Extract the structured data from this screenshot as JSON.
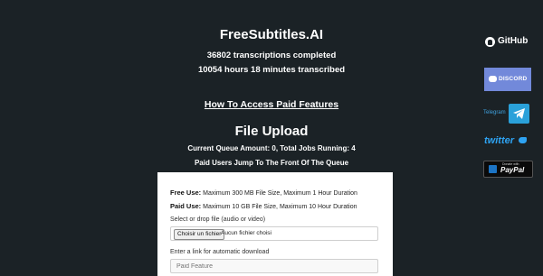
{
  "header": {
    "title": "FreeSubtitles.AI",
    "stats_transcriptions": "36802 transcriptions completed",
    "stats_hours": "10054 hours 18 minutes transcribed"
  },
  "links": {
    "paid_features": "How To Access Paid Features"
  },
  "upload": {
    "heading": "File Upload",
    "queue_status": "Current Queue Amount: 0, Total Jobs Running: 4",
    "priority_note": "Paid Users Jump To The Front Of The Queue"
  },
  "card": {
    "free_label": "Free Use:",
    "free_text": "Maximum 300 MB File Size, Maximum 1 Hour Duration",
    "paid_label": "Paid Use:",
    "paid_text": "Maximum 10 GB File Size, Maximum 10 Hour Duration",
    "select_label": "Select or drop file (audio or video)",
    "file_button": "Choisir un fichier",
    "file_status": "Aucun fichier choisi",
    "link_label": "Enter a link for automatic download",
    "link_placeholder": "Paid Feature"
  },
  "sidebar": {
    "github": "GitHub",
    "discord": "DISCORD",
    "telegram": "Telegram",
    "twitter": "twitter",
    "paypal_small": "Donate with",
    "paypal": "PayPal"
  },
  "icons": [
    "github-icon",
    "discord-icon",
    "telegram-icon",
    "twitter-icon",
    "paypal-icon"
  ],
  "colors": {
    "background": "#1b2226",
    "discord": "#7289da",
    "telegram": "#2aa1da",
    "twitter": "#2ea3f2",
    "paypal_blue": "#1c74c4"
  }
}
